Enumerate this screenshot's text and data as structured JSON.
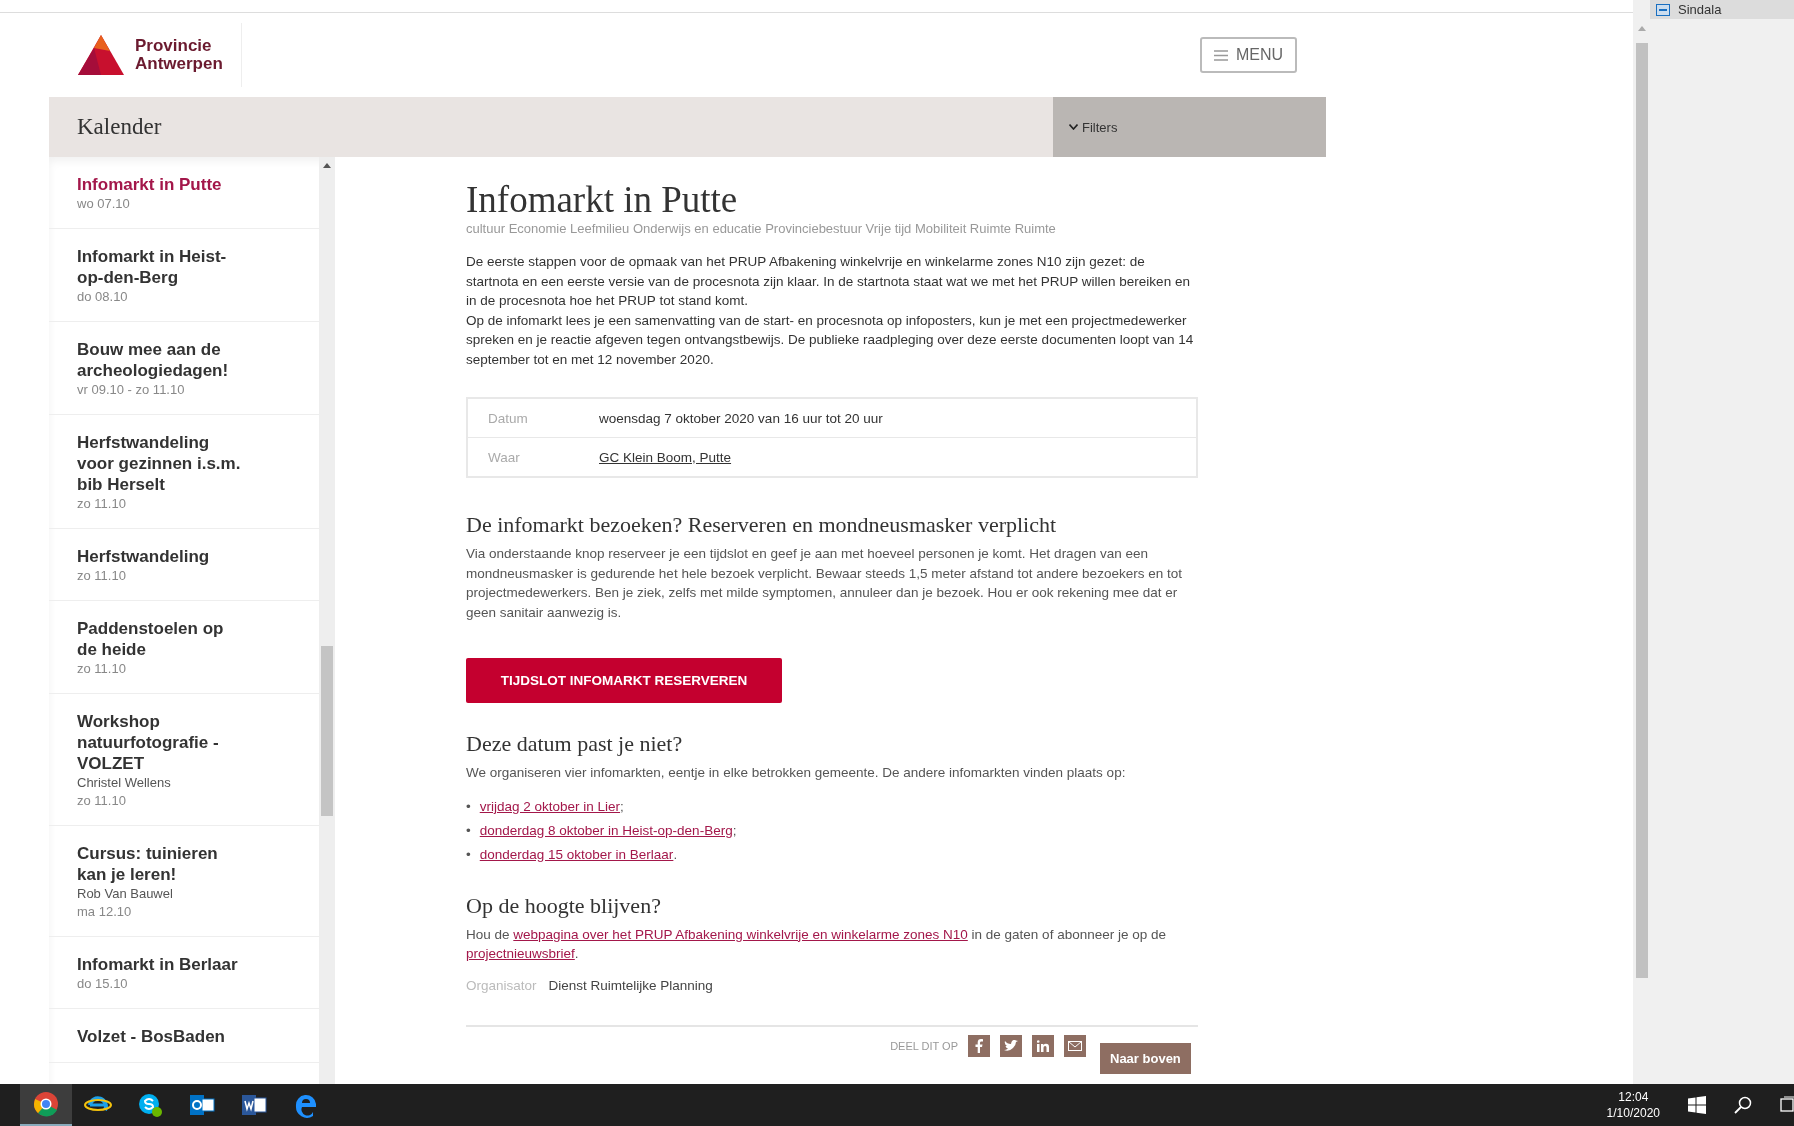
{
  "browser": {
    "side_panel_item": "Sindala"
  },
  "header": {
    "logo": {
      "line_1": "Provincie",
      "line_2": "Antwerpen"
    },
    "menu_button": "MENU"
  },
  "calendar_bar": {
    "title": "Kalender",
    "filters": "Filters"
  },
  "events": [
    {
      "title": "Infomarkt in Putte",
      "date": "wo 07.10",
      "selected": true
    },
    {
      "title": "Infomarkt in Heist-op-den-Berg",
      "date": "do 08.10",
      "selected": false
    },
    {
      "title": "Bouw mee aan de archeologiedagen!",
      "date": "vr 09.10 - zo 11.10",
      "selected": false
    },
    {
      "title": "Herfstwandeling voor gezinnen i.s.m. bib Herselt",
      "date": "zo 11.10",
      "selected": false
    },
    {
      "title": "Herfstwandeling",
      "date": "zo 11.10",
      "selected": false
    },
    {
      "title": "Paddenstoelen op de heide",
      "date": "zo 11.10",
      "selected": false
    },
    {
      "title": "Workshop natuurfotografie - VOLZET",
      "person": "Christel Wellens",
      "date": "zo 11.10",
      "selected": false
    },
    {
      "title": "Cursus: tuinieren kan je leren!",
      "person": "Rob Van Bauwel",
      "date": "ma 12.10",
      "selected": false
    },
    {
      "title": "Infomarkt in Berlaar",
      "date": "do 15.10",
      "selected": false
    },
    {
      "title": "Volzet - BosBaden",
      "selected": false
    }
  ],
  "article": {
    "title": "Infomarkt in Putte",
    "tags": "cultuur Economie Leefmilieu Onderwijs en educatie Provinciebestuur Vrije tijd Mobiliteit Ruimte Ruimte",
    "intro": [
      "De eerste stappen voor de opmaak van het PRUP Afbakening winkelvrije en winkelarme zones N10 zijn gezet: de startnota en een eerste versie van de procesnota zijn klaar. In de startnota staat wat we met het PRUP willen bereiken en in de procesnota hoe het PRUP tot stand komt.",
      "Op de infomarkt lees je een samenvatting van de start- en procesnota op infoposters, kun je met een projectmedewerker spreken en je reactie afgeven tegen ontvangstbewijs. De publieke raadpleging over deze eerste documenten loopt van 14 september tot en met 12 november 2020."
    ],
    "details": [
      {
        "label": "Datum",
        "value": "woensdag 7 oktober 2020 van 16 uur tot 20 uur",
        "kind": "text"
      },
      {
        "label": "Waar",
        "value": "GC Klein Boom, Putte",
        "kind": "link"
      }
    ],
    "visit": {
      "heading": "De infomarkt bezoeken? Reserveren en mondneusmasker verplicht",
      "text": "Via onderstaande knop reserveer je een tijdslot en geef je aan met hoeveel personen je komt. Het dragen van een mondneusmasker is gedurende het hele bezoek verplicht. Bewaar steeds 1,5 meter afstand tot andere bezoekers en tot projectmedewerkers. Ben je ziek, zelfs met milde symptomen, annuleer dan je bezoek. Hou er ook rekening mee dat er geen sanitair aanwezig is.",
      "button": "TIJDSLOT INFOMARKT RESERVEREN"
    },
    "other_dates": {
      "heading": "Deze datum past je niet?",
      "text": "We organiseren vier infomarkten, eentje in elke betrokken gemeente. De andere infomarkten vinden plaats op:",
      "items": [
        {
          "marker": "•",
          "link": "vrijdag 2 oktober in Lier",
          "suffix": ";"
        },
        {
          "marker": "•",
          "link": "donderdag 8 oktober in Heist-op-den-Berg",
          "suffix": ";"
        },
        {
          "marker": "•",
          "link": "donderdag 15 oktober in Berlaar",
          "suffix": "."
        }
      ]
    },
    "follow": {
      "heading": "Op de hoogte blijven?",
      "parts": [
        {
          "kind": "text",
          "text": "Hou de "
        },
        {
          "kind": "link",
          "text": "webpagina over het PRUP Afbakening winkelvrije en winkelarme zones N10"
        },
        {
          "kind": "text",
          "text": " in de gaten of abonneer je op de "
        },
        {
          "kind": "link",
          "text": "projectnieuwsbrief"
        },
        {
          "kind": "text",
          "text": "."
        }
      ]
    },
    "organizer": {
      "label": "Organisator",
      "value": "Dienst Ruimtelijke Planning"
    },
    "share": {
      "label": "DEEL DIT OP",
      "back_to_top": "Naar boven"
    }
  },
  "taskbar": {
    "apps": [
      {
        "kind": "chrome",
        "selected": true
      },
      {
        "kind": "ie",
        "selected": false
      },
      {
        "kind": "skype",
        "selected": false
      },
      {
        "kind": "outlook",
        "selected": false
      },
      {
        "kind": "word",
        "selected": false
      },
      {
        "kind": "edge",
        "selected": false
      }
    ],
    "time": "12:04",
    "date": "1/10/2020"
  }
}
